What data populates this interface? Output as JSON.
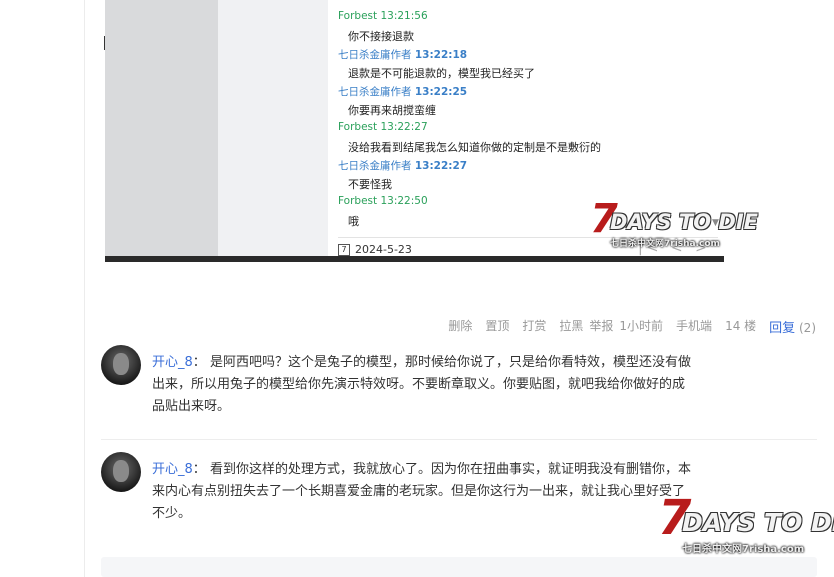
{
  "chat": {
    "messages": [
      {
        "sender": "Forbest",
        "time": "13:21:56",
        "sender_color": "green",
        "text": "你不接接退款"
      },
      {
        "sender": "七日杀金庸作者",
        "time": "13:22:18",
        "sender_color": "blue",
        "text": "退款是不可能退款的，模型我已经买了"
      },
      {
        "sender": "七日杀金庸作者",
        "time": "13:22:25",
        "sender_color": "blue",
        "text": "你要再来胡搅蛮缠"
      },
      {
        "sender": "Forbest",
        "time": "13:22:27",
        "sender_color": "green",
        "text": "没给我看到结尾我怎么知道你做的定制是不是敷衍的"
      },
      {
        "sender": "七日杀金庸作者",
        "time": "13:22:27",
        "sender_color": "blue",
        "text": "不要怪我"
      },
      {
        "sender": "Forbest",
        "time": "13:22:50",
        "sender_color": "green",
        "text": "哦"
      }
    ],
    "date": "2024-5-23",
    "calendar_glyph": "7"
  },
  "watermark": {
    "seven": "7",
    "main": "DAYS TO DIE",
    "sub": "七日杀中文网7risha.com"
  },
  "actions": {
    "delete": "删除",
    "pin": "置顶",
    "tip": "打赏",
    "block": "拉黑",
    "report": "举报",
    "time": "1小时前",
    "device": "手机端",
    "floor": "14 楼",
    "reply": "回复",
    "reply_count": "(2)"
  },
  "replies": [
    {
      "user": "开心_8",
      "colon": "：",
      "text": "是阿西吧吗？这个是兔子的模型，那时候给你说了，只是给你看特效，模型还没有做出来，所以用兔子的模型给你先演示特效呀。不要断章取义。你要贴图，就吧我给你做好的成品贴出来呀。"
    },
    {
      "user": "开心_8",
      "colon": "：",
      "text": "看到你这样的处理方式，我就放心了。因为你在扭曲事实，就证明我没有删错你，本来内心有点别扭失去了一个长期喜爱金庸的老玩家。但是你这行为一出来，就让我心里好受了不少。"
    }
  ],
  "colors": {
    "link_blue": "#3a6ed8",
    "chat_green": "#2aa05a",
    "chat_blue": "#3a7fc7",
    "logo_red": "#b81c1c"
  }
}
